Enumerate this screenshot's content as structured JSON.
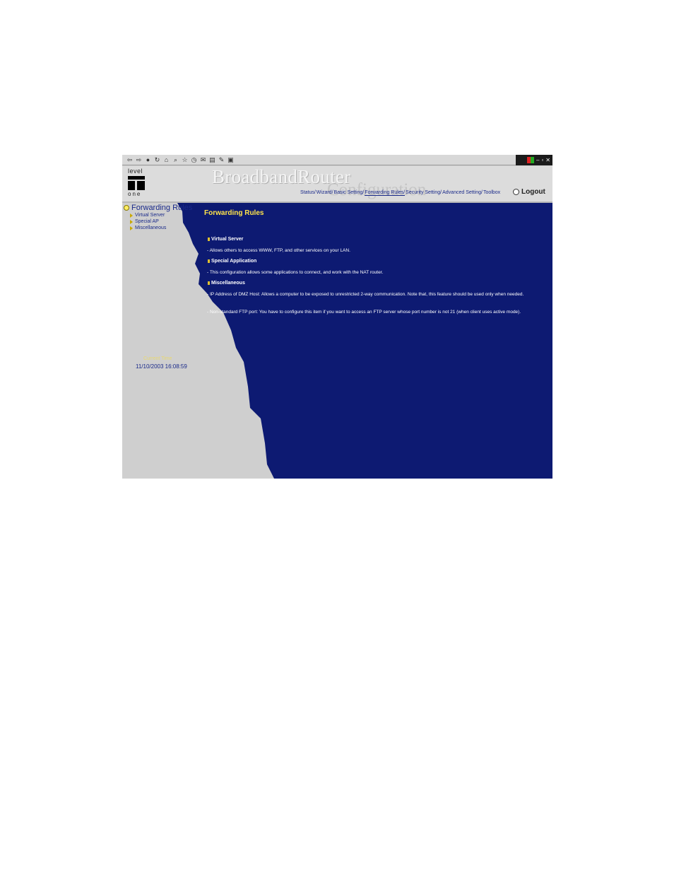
{
  "header": {
    "brand": "BroadbandRouter",
    "subbrand": "Configuration",
    "logo_top": "level",
    "logo_bottom": "one",
    "nav": [
      "Status/",
      "Wizard/",
      "Basic Setting/",
      "Forwarding Rules/",
      "Security Setting/",
      "Advanced Setting/",
      "Toolbox"
    ],
    "logout": "Logout"
  },
  "sidebar": {
    "title": "Forwarding Rules",
    "items": [
      "Virtual Server",
      "Special AP",
      "Miscellaneous"
    ],
    "current_time_label": "Current Time",
    "current_time_value": "11/10/2003 16:08:59"
  },
  "main": {
    "title": "Forwarding Rules",
    "sections": [
      {
        "title": "Virtual Server",
        "desc": "- Allows others to access WWW, FTP, and other services on your LAN."
      },
      {
        "title": "Special Application",
        "desc": "- This configuration allows some applications to connect, and work with the NAT router."
      },
      {
        "title": "Miscellaneous",
        "desc1": "- IP Address of DMZ Host: Allows a computer to be exposed to unrestricted 2-way communication. Note that, this feature should be used only when needed.",
        "desc2": "- Non-standard FTP port: You have to configure this item if you want to access an FTP server whose port number is not 21 (when client uses active mode)."
      }
    ]
  },
  "colors": {
    "content_bg": "#0d1a72",
    "sidebar_bg": "#cfcfcf",
    "title_yellow": "#ffe44a",
    "link_blue": "#1a2a8a"
  }
}
